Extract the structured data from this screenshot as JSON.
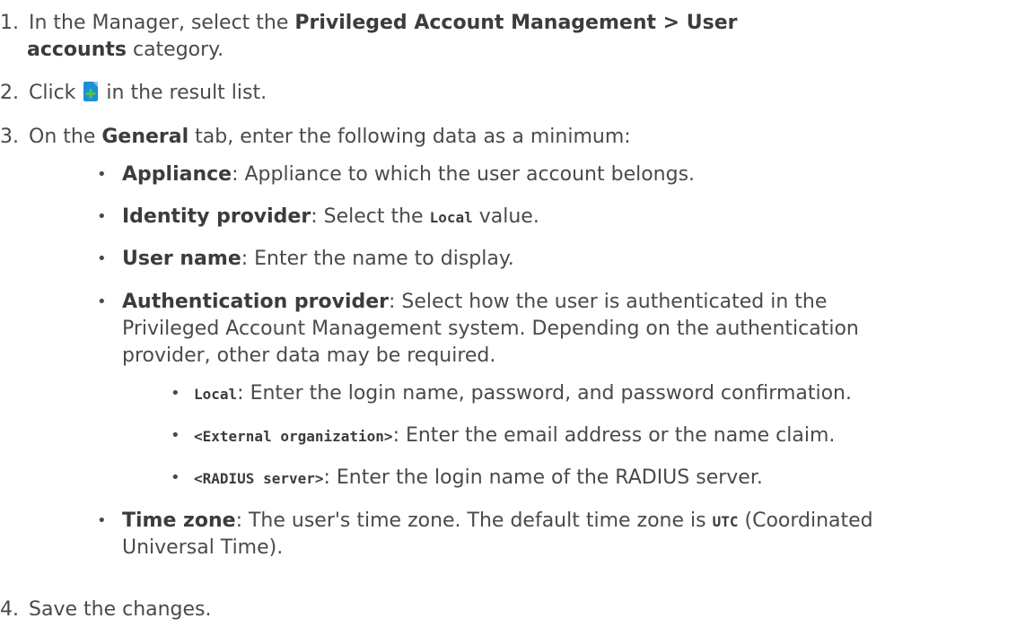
{
  "steps": [
    {
      "number": "1.",
      "text_a": "In the Manager, select the ",
      "bold_a": "Privileged Account Management > User",
      "bold_b": "accounts",
      "text_b": " category."
    },
    {
      "number": "2.",
      "text_a": "Click ",
      "icon": "new-item-icon",
      "text_b": " in the result list."
    },
    {
      "number": "3.",
      "text_a": "On the ",
      "bold_a": "General",
      "text_b": " tab, enter the following data as a minimum:"
    },
    {
      "number": "4.",
      "text_a": "Save the changes."
    }
  ],
  "fields": [
    {
      "label": "Appliance",
      "desc": ": Appliance to which the user account belongs."
    },
    {
      "label": "Identity provider",
      "desc_a": ": Select the ",
      "code": "Local",
      "desc_b": " value."
    },
    {
      "label": "User name",
      "desc": ": Enter the name to display."
    },
    {
      "label": "Authentication provider",
      "desc_lines": [
        ": Select how the user is authenticated in the",
        "Privileged Account Management system. Depending on the authentication",
        "provider, other data may be required."
      ]
    },
    {
      "label": "Time zone",
      "desc_a": ": The user's time zone. The default time zone is ",
      "code": "UTC",
      "desc_b": " (Coordinated",
      "desc_line2": "Universal Time)."
    }
  ],
  "auth_options": [
    {
      "code": "Local",
      "desc": ": Enter the login name, password, and password confirmation."
    },
    {
      "code": "<External organization>",
      "desc": ": Enter the email address or the name claim."
    },
    {
      "code": "<RADIUS server>",
      "desc": ": Enter the login name of the RADIUS server."
    }
  ],
  "bullet_char": "•",
  "colors": {
    "text": "#4a4a4a",
    "icon_blue": "#1a8fd8",
    "icon_green": "#4fbf5a"
  }
}
